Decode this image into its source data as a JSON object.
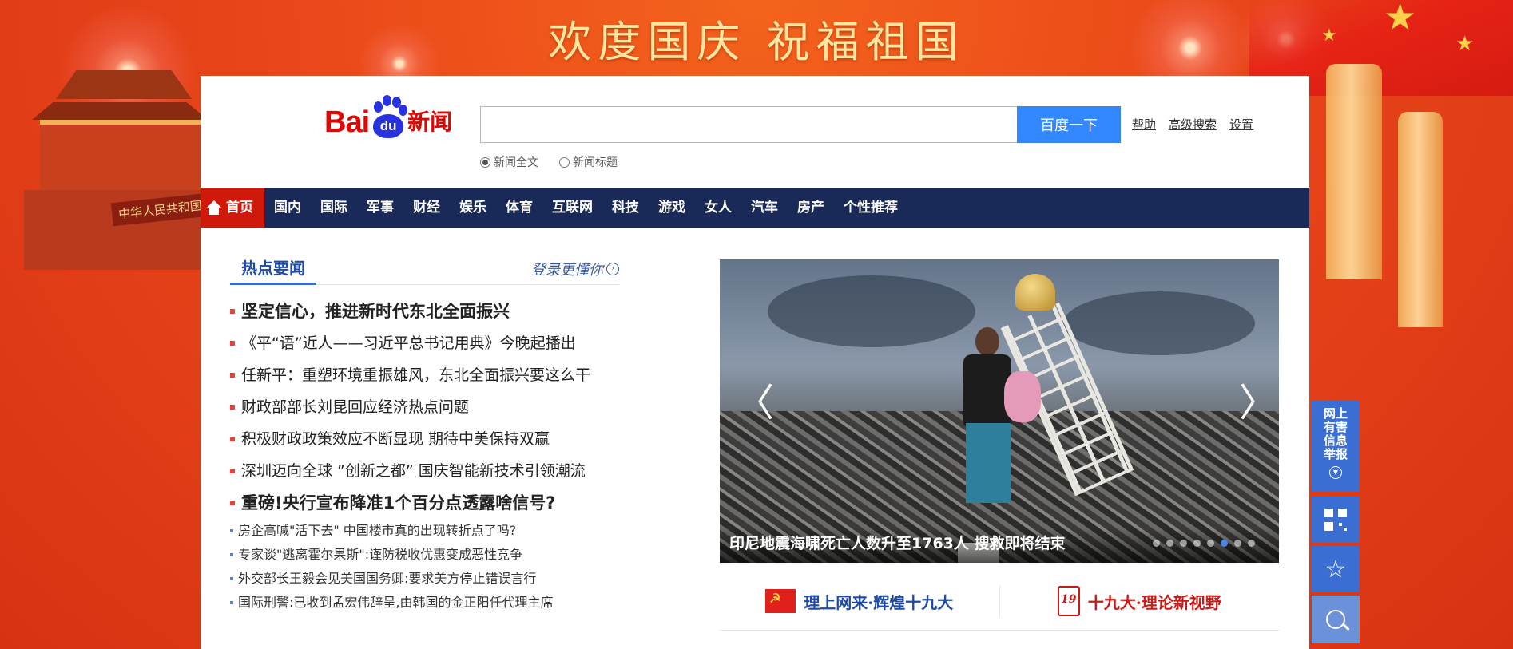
{
  "banner": {
    "title": "欢度国庆  祝福祖国",
    "gate_sign": "中华人民共和国"
  },
  "logo": {
    "bai": "Bai",
    "du": "du",
    "news": "新闻"
  },
  "search": {
    "value": "",
    "button_label": "百度一下",
    "links": [
      "帮助",
      "高级搜索",
      "设置"
    ],
    "options": [
      {
        "label": "新闻全文",
        "checked": true
      },
      {
        "label": "新闻标题",
        "checked": false
      }
    ]
  },
  "nav": {
    "home": "首页",
    "items": [
      "国内",
      "国际",
      "军事",
      "财经",
      "娱乐",
      "体育",
      "互联网",
      "科技",
      "游戏",
      "女人",
      "汽车",
      "房产",
      "个性推荐"
    ]
  },
  "hot": {
    "title": "热点要闻",
    "login_prompt": "登录更懂你",
    "items": [
      {
        "text": "坚定信心，推进新时代东北全面振兴",
        "size": "big"
      },
      {
        "text": "《平“语”近人——习近平总书记用典》今晚起播出",
        "size": "mid"
      },
      {
        "text": "任新平：重塑环境重振雄风，东北全面振兴要这么干",
        "size": "mid"
      },
      {
        "text": "财政部部长刘昆回应经济热点问题",
        "size": "mid"
      },
      {
        "text": "积极财政政策效应不断显现 期待中美保持双赢",
        "size": "mid"
      },
      {
        "text": "深圳迈向全球 ”创新之都”   国庆智能新技术引领潮流",
        "size": "mid"
      },
      {
        "text": "重磅!央行宣布降准1个百分点透露啥信号?",
        "size": "big"
      },
      {
        "text": "房企高喊\"活下去\" 中国楼市真的出现转折点了吗?",
        "size": "small"
      },
      {
        "text": "专家谈\"逃离霍尔果斯\":谨防税收优惠变成恶性竞争",
        "size": "small"
      },
      {
        "text": "外交部长王毅会见美国国务卿:要求美方停止错误言行",
        "size": "small"
      },
      {
        "text": "国际刑警:已收到孟宏伟辞呈,由韩国的金正阳任代理主席",
        "size": "small"
      }
    ]
  },
  "carousel": {
    "caption": "印尼地震海啸死亡人数升至1763人  搜救即将结束",
    "prev": "〈",
    "next": "〉",
    "slide_count": 8,
    "active_index": 5
  },
  "promos": {
    "left": "理上网来·辉煌十九大",
    "right": "十九大·理论新视野",
    "right_badge": "19"
  },
  "sidebar": {
    "report": "网上有害信息举报",
    "report_icon": "chevron-down-icon",
    "qr_icon": "qr-code-icon",
    "star": "☆",
    "search_icon": "search-icon"
  },
  "colors": {
    "nav_bg": "#1a2a58",
    "home_bg": "#cf1a0b",
    "search_btn": "#3388ff",
    "hot_title": "#1f4aa8",
    "sidebar": "#3a6ed3"
  }
}
